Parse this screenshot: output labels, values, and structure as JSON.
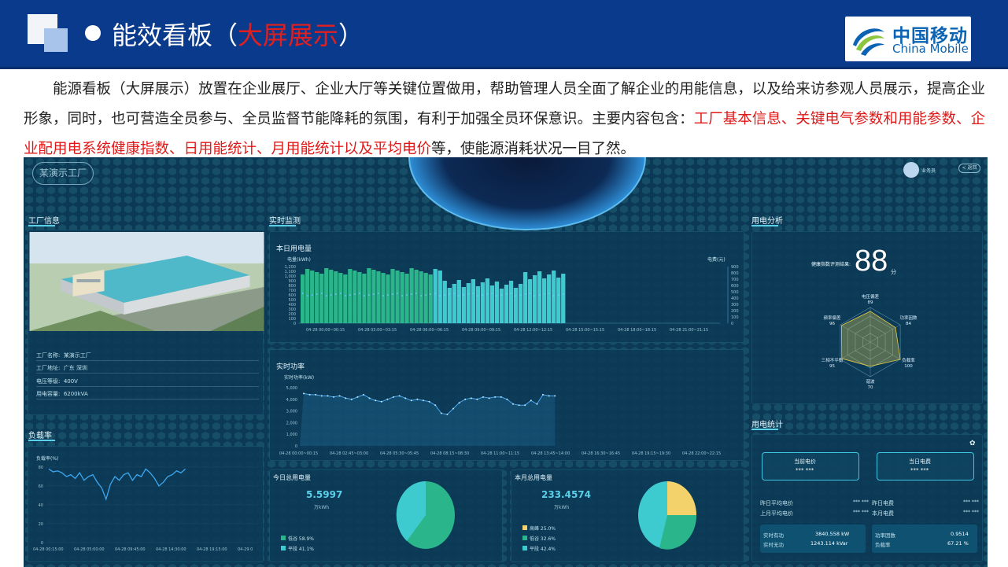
{
  "slide": {
    "title_prefix": "能效看板（",
    "title_highlight": "大屏展示",
    "title_suffix": "）",
    "logo_cn": "中国移动",
    "logo_en": "China Mobile",
    "paragraph_plain": "能源看板（大屏展示）放置在企业展厅、企业大厅等关键位置做用，帮助管理人员全面了解企业的用能信息，以及给来访参观人员展示，提高企业形象，同时，也可营造全员参与、全员监督节能降耗的氛围，有利于加强全员环保意识。主要内容包含：",
    "paragraph_highlight": "工厂基本信息、关键电气参数和用能参数、企业配用电系统健康指数、日用能统计、月用能统计以及平均电价",
    "paragraph_tail": "等，使能源消耗状况一目了然。"
  },
  "dashboard": {
    "site_name": "某演示工厂",
    "user_name": "业务员",
    "back_label": "< 返回",
    "sections": {
      "factory_info": "工厂信息",
      "realtime": "实时监测",
      "power_analysis": "用电分析",
      "load_rate": "负载率",
      "power_stats": "用电统计"
    },
    "factory": {
      "rows": [
        {
          "label": "工厂名称:",
          "value": "某演示工厂"
        },
        {
          "label": "工厂地址:",
          "value": "广东 深圳"
        },
        {
          "label": "电压等级:",
          "value": "400V"
        },
        {
          "label": "用电容量:",
          "value": "6200kVA"
        }
      ]
    },
    "daily_energy": {
      "title": "本日用电量",
      "y_label_left": "电量(kWh)",
      "y_label_right": "电费(元)",
      "y_ticks_left": [
        "1,200",
        "1,100",
        "1,000",
        "900",
        "800",
        "700",
        "600",
        "500",
        "400",
        "300",
        "200",
        "100",
        "0"
      ],
      "y_ticks_right": [
        "900",
        "800",
        "700",
        "600",
        "500",
        "400",
        "300",
        "200",
        "100",
        "0"
      ],
      "x_ticks": [
        "04-28 00:00~00:15",
        "04-28 03:00~03:15",
        "04-28 06:00~06:15",
        "04-28 09:00~09:15",
        "04-28 12:00~12:15",
        "04-28 15:00~15:15",
        "04-28 18:00~18:15",
        "04-28 21:00~21:15"
      ]
    },
    "realtime_power": {
      "title": "实时功率",
      "y_label": "实时功率(kW)",
      "y_ticks": [
        "5,000",
        "4,000",
        "3,000",
        "2,000",
        "1,000",
        "0"
      ],
      "x_ticks": [
        "04-28 00:00~00:15",
        "04-28 02:45~03:00",
        "04-28 05:30~05:45",
        "04-28 08:15~08:30",
        "04-28 11:00~11:15",
        "04-28 13:45~14:00",
        "04-28 16:30~16:45",
        "04-28 19:15~19:30",
        "04-28 22:00~22:15"
      ]
    },
    "today_total": {
      "title": "今日总用电量",
      "value": "5.5997",
      "unit": "万kWh",
      "legend": [
        {
          "label": "低谷 58.9%",
          "color": "#2bb58a"
        },
        {
          "label": "平段 41.1%",
          "color": "#3ecbd0"
        }
      ]
    },
    "month_total": {
      "title": "本月总用电量",
      "value": "233.4574",
      "unit": "万kWh",
      "legend": [
        {
          "label": "高峰 25.0%",
          "color": "#f3d26b"
        },
        {
          "label": "低谷 32.6%",
          "color": "#2bb58a"
        },
        {
          "label": "平段 42.4%",
          "color": "#3ecbd0"
        }
      ]
    },
    "health": {
      "label": "健康指数评测结果:",
      "score": "88",
      "unit": "分",
      "radar": [
        {
          "name": "电压偏差",
          "value": "89"
        },
        {
          "name": "功率因数",
          "value": "84"
        },
        {
          "name": "负载率",
          "value": "100"
        },
        {
          "name": "谐波",
          "value": "70"
        },
        {
          "name": "三相不平衡",
          "value": "95"
        },
        {
          "name": "频率偏差",
          "value": "96"
        }
      ]
    },
    "load": {
      "y_label": "负载率(%)",
      "y_ticks": [
        "80",
        "60",
        "40",
        "20",
        "0"
      ],
      "x_ticks": [
        "04-28 00:15:00",
        "04-28 05:00:00",
        "04-28 09:45:00",
        "04-28 14:30:00",
        "04-28 19:15:00",
        "04-29 0"
      ]
    },
    "stats": {
      "current_price_label": "当前电价",
      "current_price_value": "*** ***",
      "today_fee_label": "当日电费",
      "today_fee_value": "*** ***",
      "rows_left": [
        {
          "label": "昨日平均电价",
          "value": "*** ***"
        },
        {
          "label": "上月平均电价",
          "value": "*** ***"
        }
      ],
      "rows_right": [
        {
          "label": "昨日电费",
          "value": "*** ***"
        },
        {
          "label": "本月电费",
          "value": "*** ***"
        }
      ],
      "tile_left": [
        {
          "label": "实时有功",
          "value": "3840.558 kW"
        },
        {
          "label": "实时无功",
          "value": "1243.114 kVar"
        }
      ],
      "tile_right": [
        {
          "label": "功率因数",
          "value": "0.9514"
        },
        {
          "label": "负载率",
          "value": "67.21 %"
        }
      ]
    }
  }
}
